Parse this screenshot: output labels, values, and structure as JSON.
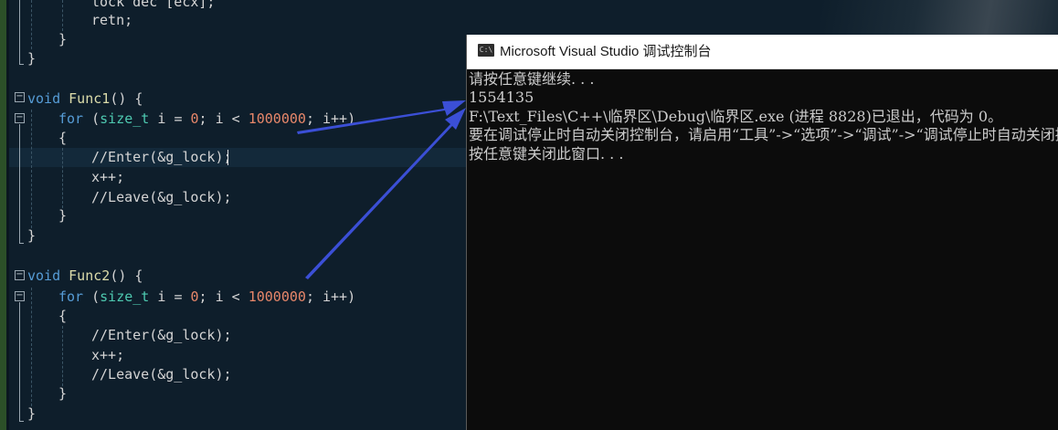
{
  "editor": {
    "lines": {
      "l1": "lock dec [ecx];",
      "l2": "retn;",
      "func1_sig_kw": "void",
      "func1_sig_name": "Func1",
      "func1_sig_rest": "() {",
      "func2_sig_kw": "void",
      "func2_sig_name": "Func2",
      "func2_sig_rest": "() {",
      "for_kw": "for",
      "for_open": " (",
      "for_type": "size_t",
      "for_var": " i ",
      "for_eq": "= ",
      "for_zero": "0",
      "for_mid": "; i < ",
      "for_limit": "1000000",
      "for_end": "; i++)",
      "open_brace": "{",
      "close_brace": "}",
      "enter_call": "//Enter(&g_lock);",
      "x_inc": "x++;",
      "leave_call": "//Leave(&g_lock);"
    },
    "fold_minus": "−"
  },
  "console": {
    "icon_label": "C:\\",
    "title": "Microsoft Visual Studio 调试控制台",
    "output": [
      "请按任意键继续. . .",
      "1554135",
      "F:\\Text_Files\\C++\\临界区\\Debug\\临界区.exe (进程 8828)已退出，代码为 0。",
      "要在调试停止时自动关闭控制台，请启用“工具”->“选项”->“调试”->“调试停止时自动关闭控制台”。",
      "按任意键关闭此窗口. . ."
    ]
  },
  "colors": {
    "editor_bg": "#0e1e2b",
    "keyword": "#569cd6",
    "function": "#dcdcaa",
    "type": "#4ec9b0",
    "number": "#e8876a",
    "arrow": "#3b4fd6",
    "console_bg": "#0c0c0c",
    "console_text": "#cccccc"
  }
}
